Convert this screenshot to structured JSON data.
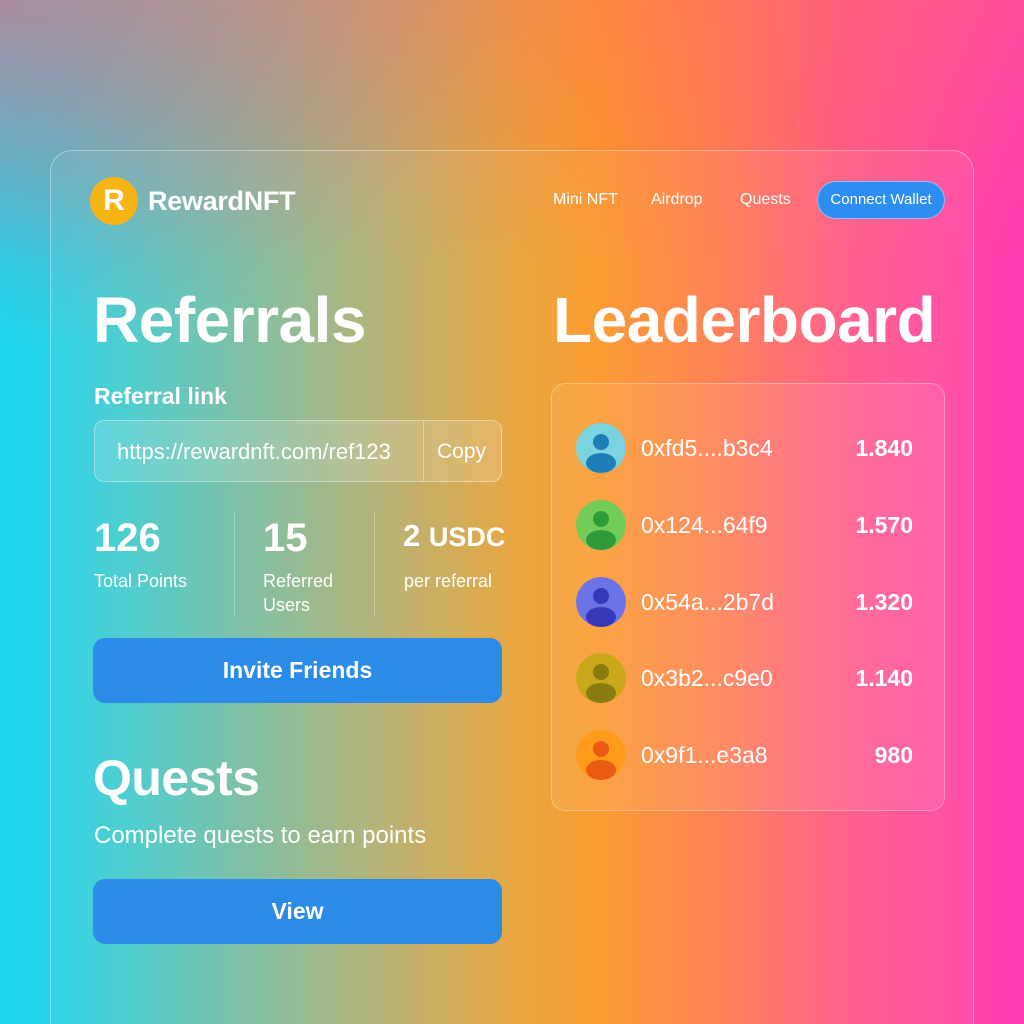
{
  "brand": {
    "logo_letter": "R",
    "name": "RewardNFT",
    "logo_color": "#f7b515"
  },
  "nav": {
    "links": [
      "Mini NFT",
      "Airdrop",
      "Quests"
    ],
    "connect_wallet": "Connect Wallet"
  },
  "referrals": {
    "title": "Referrals",
    "link_label": "Referral link",
    "link_value": "https://rewardnft.com/ref123",
    "copy_label": "Copy",
    "stats": [
      {
        "value": "126",
        "label": "Total Points"
      },
      {
        "value": "15",
        "label": "Referred Users"
      },
      {
        "value": "2",
        "unit": "USDC",
        "label": "per referral"
      }
    ],
    "invite_button": "Invite Friends"
  },
  "quests": {
    "title": "Quests",
    "subtitle": "Complete quests to earn points",
    "view_button": "View"
  },
  "leaderboard": {
    "title": "Leaderboard",
    "rows": [
      {
        "address": "0xfd5....b3c4",
        "score": "1.840",
        "avatar_bg": "#7ad3df",
        "avatar_fg": "#1e7fb8"
      },
      {
        "address": "0x124...64f9",
        "score": "1.570",
        "avatar_bg": "#74cc58",
        "avatar_fg": "#2f9a3a"
      },
      {
        "address": "0x54a...2b7d",
        "score": "1.320",
        "avatar_bg": "#6b74e6",
        "avatar_fg": "#3538b8"
      },
      {
        "address": "0x3b2...c9e0",
        "score": "1.140",
        "avatar_bg": "#c9a81a",
        "avatar_fg": "#8b7a10"
      },
      {
        "address": "0x9f1...e3a8",
        "score": "980",
        "avatar_bg": "#ff9a1a",
        "avatar_fg": "#ea5a12"
      }
    ]
  },
  "colors": {
    "primary_button": "#2d8be8",
    "wallet_button": "#2d8df0"
  }
}
